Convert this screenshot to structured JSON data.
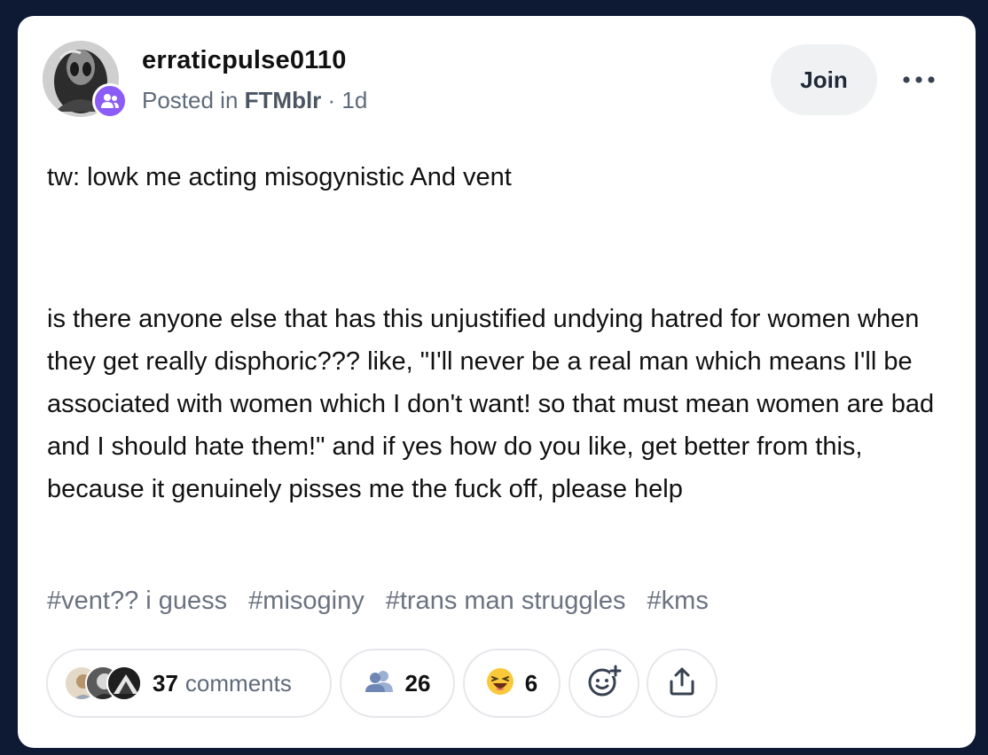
{
  "post": {
    "username": "erraticpulse0110",
    "posted_prefix": "Posted in",
    "community": "FTMblr",
    "separator": " · ",
    "age": "1d",
    "join_label": "Join",
    "title": "tw: lowk me acting misogynistic And vent",
    "body": "is there anyone else that has this unjustified undying hatred for women when they get really disphoric??? like, \"I'll never be a real man which means I'll be associated with women which I don't want! so that must mean women are bad and I should hate them!\" and if yes how do you like, get better from this, because it genuinely pisses me the fuck off, please help",
    "tags": [
      "#vent?? i guess",
      "#misoginy",
      "#trans man struggles",
      "#kms"
    ]
  },
  "actions": {
    "comments_count": "37",
    "comments_label": "comments",
    "community_count": "26",
    "reaction_count": "6",
    "icons": {
      "avatar": "user-avatar",
      "badge": "community-people-icon",
      "more": "more-options-icon",
      "community": "people-icon",
      "reaction": "laughing-emoji-icon",
      "add_reaction": "add-reaction-icon",
      "share": "share-icon"
    }
  },
  "colors": {
    "page_background": "#0e1a33",
    "badge": "#8b5cf6",
    "join_background": "#eff1f3"
  }
}
